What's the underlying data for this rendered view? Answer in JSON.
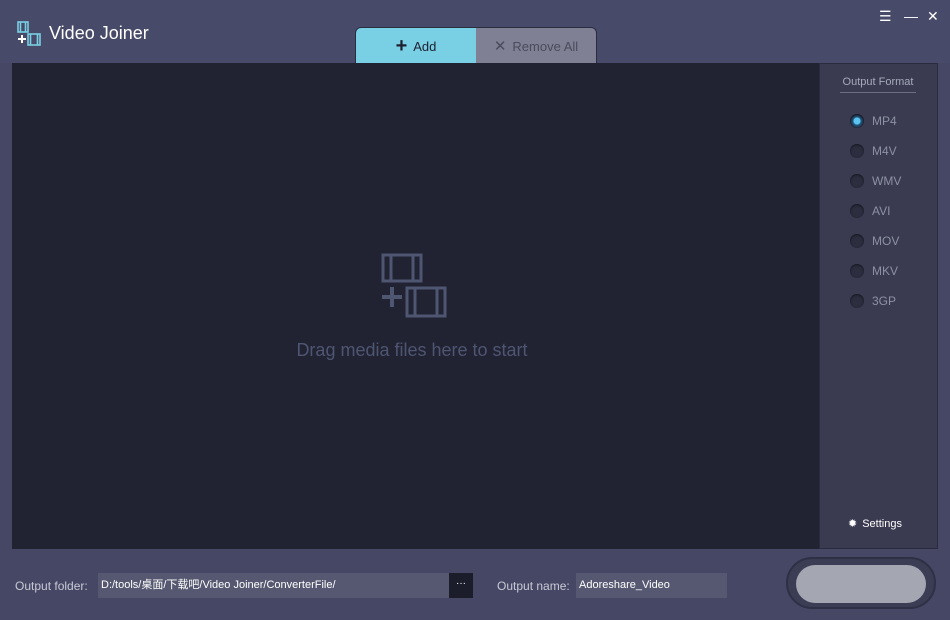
{
  "app": {
    "title": "Video Joiner",
    "logo_icon": "film-add-icon",
    "accent": "#79cfe3"
  },
  "window": {
    "menu_icon": "menu-icon",
    "minimize_icon": "minimize-icon",
    "close_icon": "close-icon"
  },
  "toolbar": {
    "add_label": "Add",
    "remove_all_label": "Remove All"
  },
  "dropzone": {
    "text": "Drag media files here to start",
    "icon": "film-add-icon"
  },
  "output_format": {
    "title": "Output Format",
    "selected": "MP4",
    "options": [
      "MP4",
      "M4V",
      "WMV",
      "AVI",
      "MOV",
      "MKV",
      "3GP"
    ]
  },
  "settings": {
    "label": "Settings",
    "icon": "gear-icon"
  },
  "footer": {
    "folder_label": "Output folder:",
    "folder_value": "D:/tools/桌面/下载吧/Video Joiner/ConverterFile/",
    "browse_label": "···",
    "name_label": "Output name:",
    "name_value": "Adoreshare_Video"
  }
}
